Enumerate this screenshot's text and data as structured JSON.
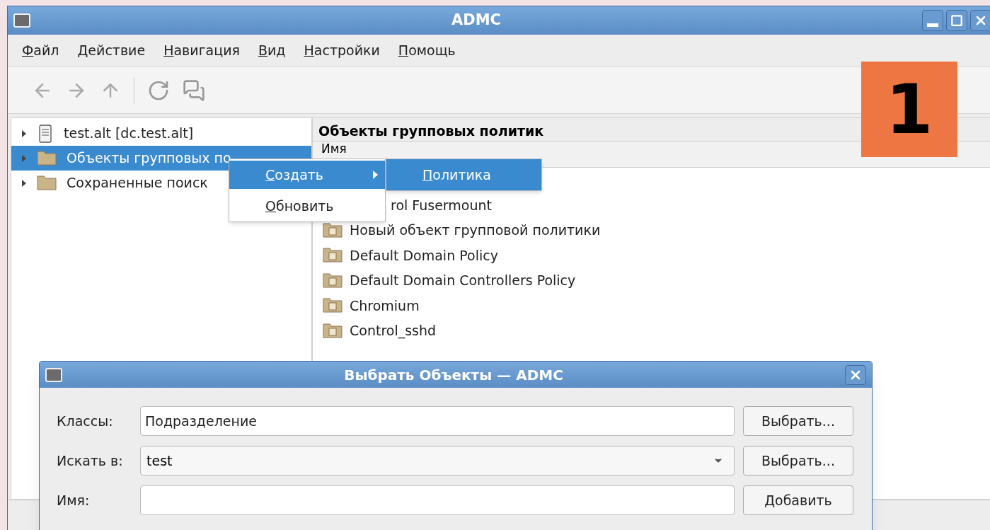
{
  "window": {
    "title": "ADMC"
  },
  "menu": [
    {
      "label": "Файл"
    },
    {
      "label": "Действие"
    },
    {
      "label": "Навигация"
    },
    {
      "label": "Вид"
    },
    {
      "label": "Настройки"
    },
    {
      "label": "Помощь"
    }
  ],
  "tree": [
    {
      "label": "test.alt [dc.test.alt]",
      "kind": "domain",
      "selected": false
    },
    {
      "label": "Объекты групповых по",
      "kind": "folder",
      "selected": true
    },
    {
      "label": "Сохраненные поиск",
      "kind": "folder",
      "selected": false
    }
  ],
  "panel": {
    "title": "Объекты групповых политик",
    "columns": [
      "Имя"
    ],
    "rows": [
      {
        "name": "rol Fusermount",
        "kind": "clipped"
      },
      {
        "name": "Новый объект групповой политики",
        "kind": "gpo"
      },
      {
        "name": "Default Domain Policy",
        "kind": "gpo"
      },
      {
        "name": "Default Domain Controllers Policy",
        "kind": "gpo"
      },
      {
        "name": "Chromium",
        "kind": "gpo"
      },
      {
        "name": "Control_sshd",
        "kind": "gpo"
      }
    ]
  },
  "context_menu": {
    "items": [
      {
        "label": "Создать",
        "selected": true,
        "submenu": true
      },
      {
        "label": "Обновить",
        "selected": false,
        "submenu": false
      }
    ],
    "submenu": [
      {
        "label": "Политика",
        "selected": true
      }
    ]
  },
  "dialog": {
    "title": "Выбрать Объекты — ADMC",
    "rows": [
      {
        "label": "Классы:",
        "kind": "text",
        "value": "Подразделение",
        "button": "Выбрать..."
      },
      {
        "label": "Искать в:",
        "kind": "select",
        "value": "test",
        "button": "Выбрать..."
      },
      {
        "label": "Имя:",
        "kind": "text",
        "button": "Добавить"
      }
    ]
  },
  "badge": {
    "label": "1"
  }
}
